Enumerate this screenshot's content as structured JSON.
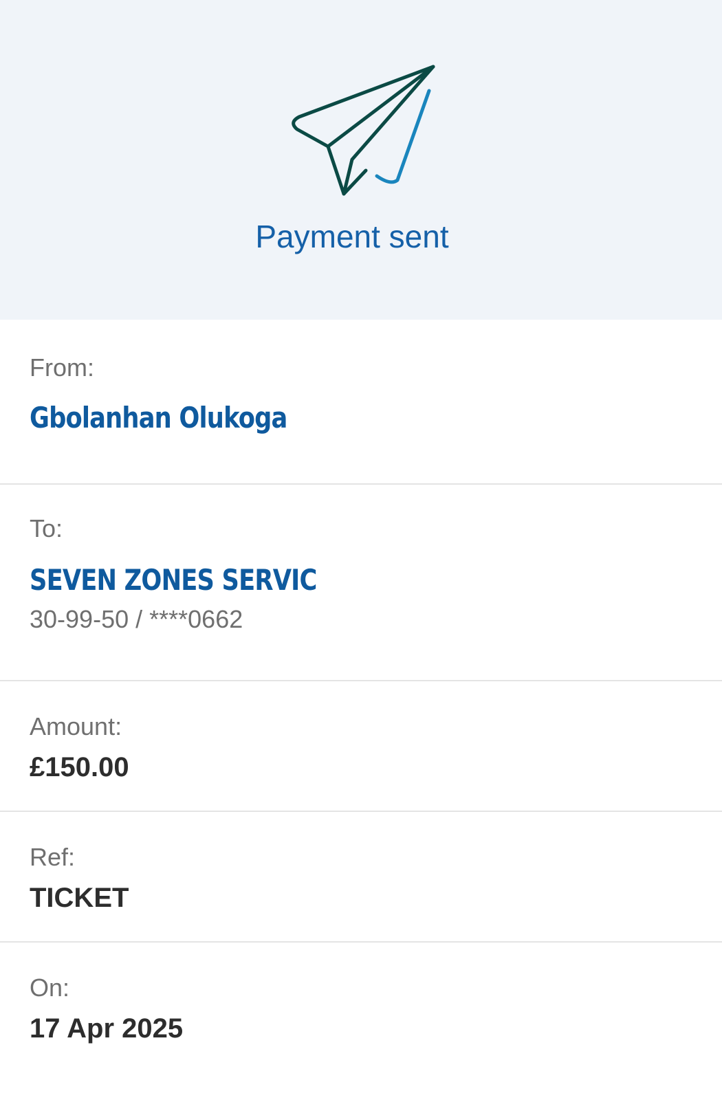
{
  "header": {
    "icon": "paper-plane-check-icon",
    "title": "Payment sent"
  },
  "from": {
    "label": "From:",
    "name": "Gbolanhan Olukoga"
  },
  "to": {
    "label": "To:",
    "name": "SEVEN ZONES SERVIC",
    "account": "30-99-50 / ****0662"
  },
  "amount": {
    "label": "Amount:",
    "value": "£150.00"
  },
  "ref": {
    "label": "Ref:",
    "value": "TICKET"
  },
  "on": {
    "label": "On:",
    "value": "17 Apr 2025"
  },
  "colors": {
    "header_bg": "#f0f4f9",
    "brand_blue": "#1560a8",
    "plane_dark": "#0b4a45",
    "plane_accent": "#1a85bd"
  }
}
